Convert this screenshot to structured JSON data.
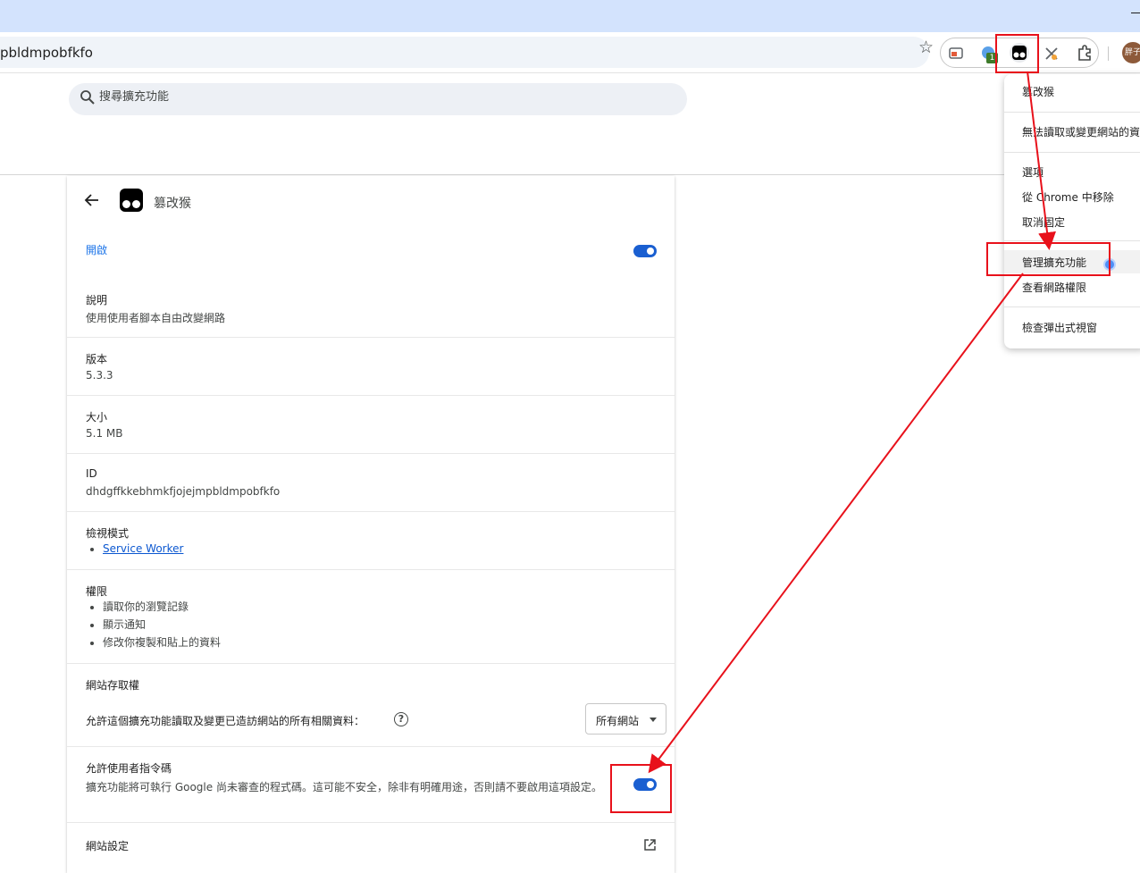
{
  "browser": {
    "url": "pbldmpobfkfo",
    "extension_badge": "1",
    "avatar_text": "胖子"
  },
  "search": {
    "placeholder": "搜尋擴充功能"
  },
  "extension": {
    "title": "篡改猴",
    "enable_label": "開啟",
    "enabled": true,
    "description_label": "說明",
    "description": "使用使用者腳本自由改變網路",
    "version_label": "版本",
    "version": "5.3.3",
    "size_label": "大小",
    "size": "5.1 MB",
    "id_label": "ID",
    "id": "dhdgffkkebhmkfjojejmpbldmpobfkfo",
    "inspect_label": "檢視模式",
    "inspect_views": [
      "Service Worker"
    ],
    "permissions_label": "權限",
    "permissions": [
      "讀取你的瀏覽記錄",
      "顯示通知",
      "修改你複製和貼上的資料"
    ],
    "site_access_label": "網站存取權",
    "site_access_desc": "允許這個擴充功能讀取及變更已造訪網站的所有相關資料：",
    "site_access_value": "所有網站",
    "user_scripts_label": "允許使用者指令碼",
    "user_scripts_desc": "擴充功能將可執行 Google 尚未審查的程式碼。這可能不安全，除非有明確用途，否則請不要啟用這項設定。",
    "user_scripts_enabled": true,
    "site_settings_label": "網站設定"
  },
  "context_menu": {
    "items": [
      "篡改猴",
      "無法讀取或變更網站的資料",
      "選項",
      "從 Chrome 中移除",
      "取消固定",
      "管理擴充功能",
      "查看網路權限",
      "檢查彈出式視窗"
    ]
  },
  "colors": {
    "accent": "#1a5fd1",
    "annotation": "#e8111b",
    "titlebar": "#d3e3fd"
  }
}
